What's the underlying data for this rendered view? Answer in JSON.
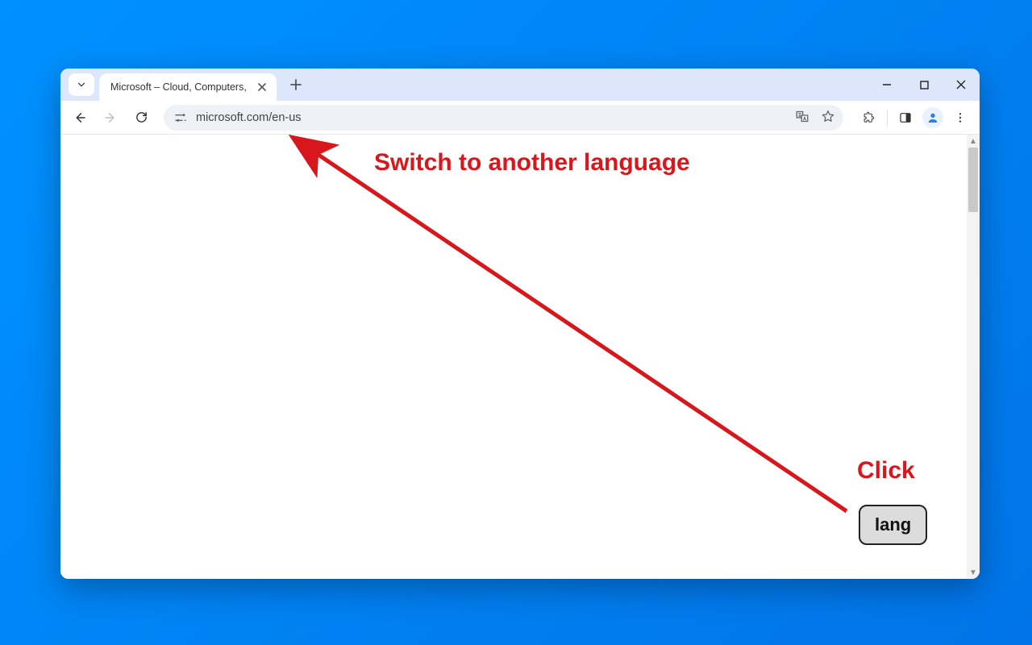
{
  "tab": {
    "title": "Microsoft – Cloud, Computers, "
  },
  "address": {
    "url": "microsoft.com/en-us"
  },
  "annotation": {
    "headline": "Switch to another language",
    "click_label": "Click",
    "lang_button": "lang"
  }
}
